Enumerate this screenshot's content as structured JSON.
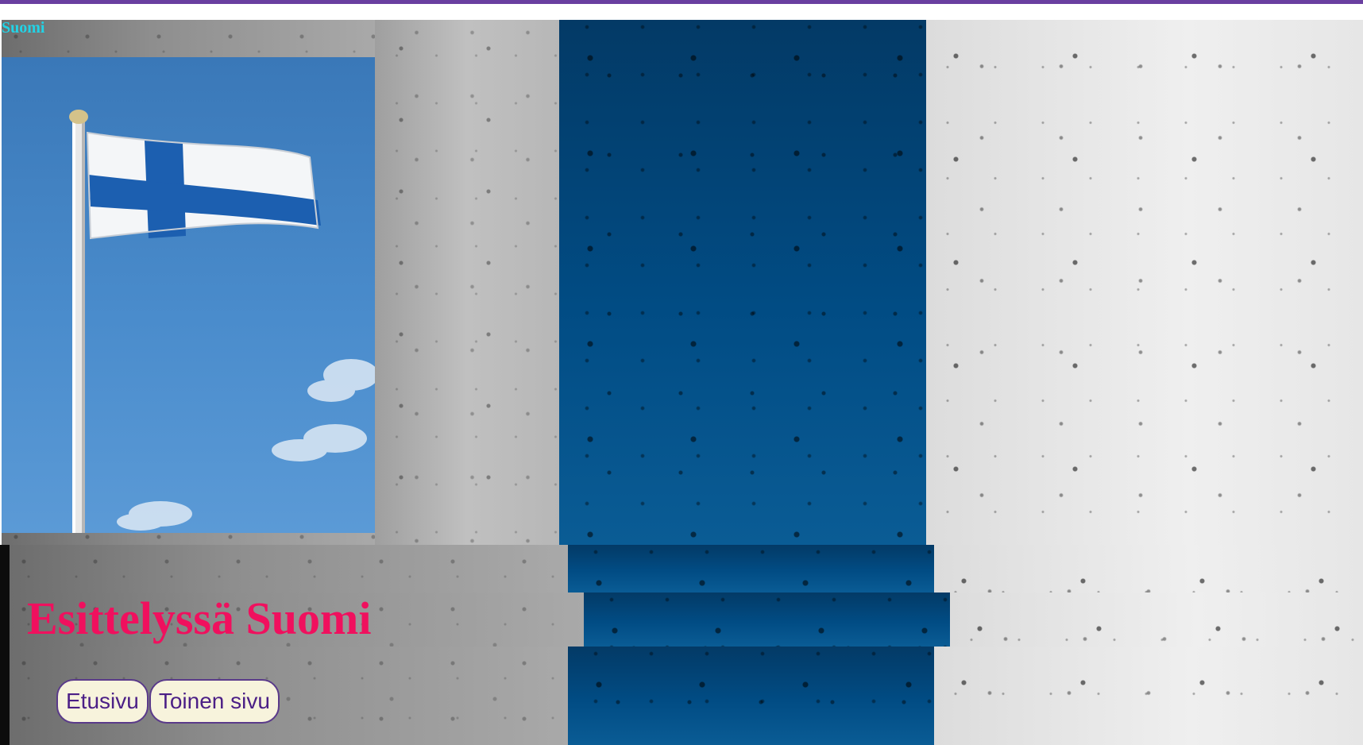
{
  "site": {
    "brand": "Suomi"
  },
  "hero": {
    "title": "Esittelyssä Suomi"
  },
  "nav": {
    "items": [
      {
        "label": "Etusivu"
      },
      {
        "label": "Toinen sivu"
      }
    ]
  },
  "colors": {
    "accent_bar": "#6a3fa0",
    "brand_text": "#22d3e6",
    "title_text": "#f0105e",
    "button_bg": "#f7f3dc",
    "button_text": "#4b1f86",
    "flag_blue": "#1b5fae"
  }
}
